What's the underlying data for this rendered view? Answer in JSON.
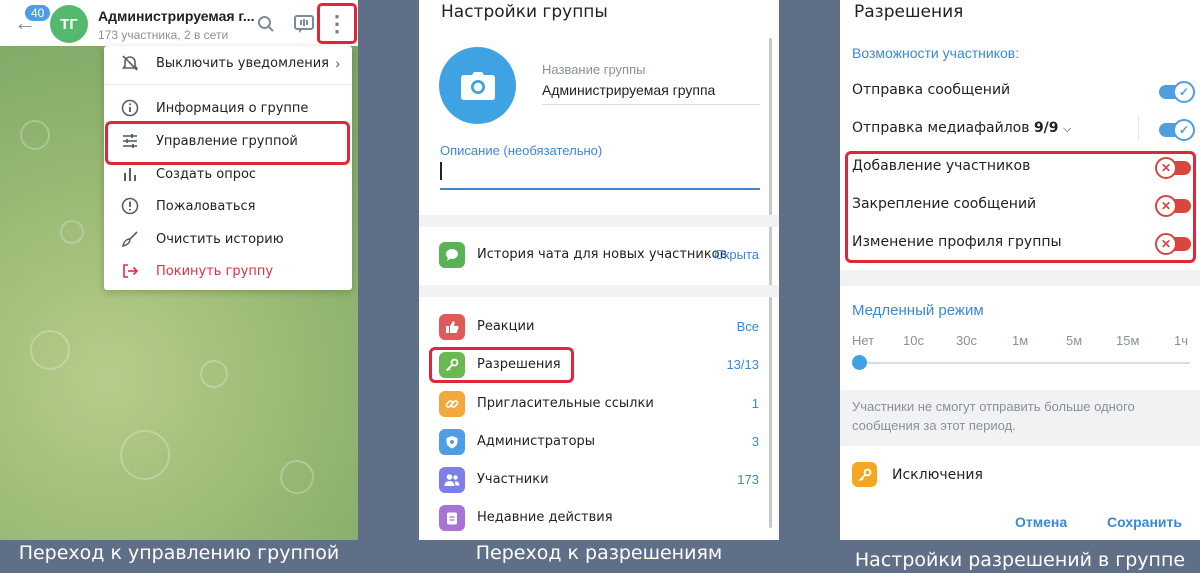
{
  "panel1": {
    "badge": "40",
    "avatar_initials": "ТГ",
    "group_title": "Администрируемая г...",
    "group_subtitle": "173 участника, 2 в сети",
    "menu": {
      "mute": "Выключить уведомления",
      "info": "Информация о группе",
      "manage": "Управление группой",
      "poll": "Создать опрос",
      "report": "Пожаловаться",
      "clear": "Очистить историю",
      "leave": "Покинуть группу"
    },
    "caption": "Переход к управлению группой"
  },
  "panel2": {
    "title": "Настройки группы",
    "name_label": "Название группы",
    "name_value": "Администрируемая группа",
    "description_label": "Описание (необязательно)",
    "history": {
      "label": "История чата для новых участников",
      "value": "Скрыта"
    },
    "rows": {
      "reactions": {
        "label": "Реакции",
        "value": "Все"
      },
      "permissions": {
        "label": "Разрешения",
        "value": "13/13"
      },
      "invites": {
        "label": "Пригласительные ссылки",
        "value": "1"
      },
      "admins": {
        "label": "Администраторы",
        "value": "3"
      },
      "members": {
        "label": "Участники",
        "value": "173"
      },
      "recent": {
        "label": "Недавние действия"
      }
    },
    "caption": "Переход к разрешениям"
  },
  "panel3": {
    "title": "Разрешения",
    "section_title": "Возможности участников:",
    "perms": {
      "send_messages": {
        "label": "Отправка сообщений",
        "enabled": true
      },
      "send_media": {
        "label": "Отправка медиафайлов",
        "count": "9/9",
        "enabled": true
      },
      "add_members": {
        "label": "Добавление участников",
        "enabled": false
      },
      "pin_messages": {
        "label": "Закрепление сообщений",
        "enabled": false
      },
      "change_info": {
        "label": "Изменение профиля группы",
        "enabled": false
      }
    },
    "slow_mode": {
      "title": "Медленный режим",
      "ticks": [
        "Нет",
        "10с",
        "30с",
        "1м",
        "5м",
        "15м",
        "1ч"
      ],
      "selected": "Нет",
      "info": "Участники не смогут отправить больше одного сообщения за этот период."
    },
    "exceptions": "Исключения",
    "cancel": "Отмена",
    "save": "Сохранить",
    "caption": "Настройки разрешений в группе"
  },
  "colors": {
    "accent": "#3a88d4",
    "highlight": "#e0263a",
    "toggle_on": "#4d9fe0",
    "toggle_off": "#d9453f"
  }
}
